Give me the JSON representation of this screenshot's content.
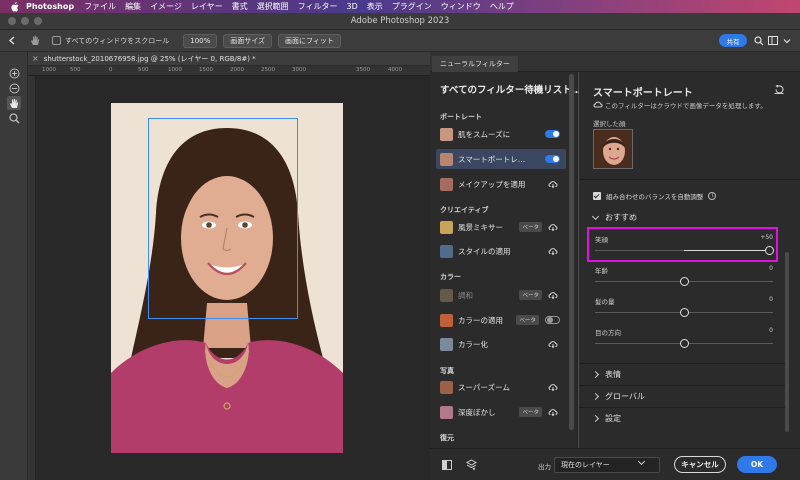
{
  "menubar": {
    "app_name": "Photoshop",
    "items": [
      "ファイル",
      "編集",
      "イメージ",
      "レイヤー",
      "書式",
      "選択範囲",
      "フィルター",
      "3D",
      "表示",
      "プラグイン",
      "ウィンドウ",
      "ヘルプ"
    ]
  },
  "window": {
    "title": "Adobe Photoshop 2023"
  },
  "options_bar": {
    "scroll_all_label": "すべてのウィンドウをスクロール",
    "zoom_button": "100%",
    "fit_screen_button": "画面サイズ",
    "fill_screen_button": "画面にフィット",
    "share_button": "共有"
  },
  "document": {
    "tab_title": "shutterstock_2010676958.jpg @ 25% (レイヤー 0, RGB/8#) *",
    "ruler_ticks": [
      "1000",
      "500",
      "0",
      "500",
      "1000",
      "1500",
      "2000",
      "2500",
      "3000",
      "3500",
      "4000"
    ]
  },
  "neural_filters": {
    "tab_label": "ニューラルフィルター",
    "list_header": "すべてのフィルター待機リスト…",
    "sections": {
      "portrait": "ポートレート",
      "creative": "クリエイティブ",
      "color": "カラー",
      "photo": "写真",
      "restore": "復元"
    },
    "filters": {
      "skin_smoothing": "肌をスムーズに",
      "smart_portrait": "スマートポートレ…",
      "makeup_transfer": "メイクアップを適用",
      "landscape_mixer": "風景ミキサー",
      "style_transfer": "スタイルの適用",
      "harmonization": "調和",
      "color_transfer": "カラーの適用",
      "colorize": "カラー化",
      "super_zoom": "スーパーズーム",
      "depth_blur": "深度ぼかし"
    },
    "beta_label": "ベータ"
  },
  "settings": {
    "title": "スマートポートレート",
    "cloud_note": "このフィルターはクラウドで画像データを処理します。",
    "selected_face_label": "選択した顔",
    "auto_balance_label": "組み合わせのバランスを自動調整",
    "auto_balance_checked": true,
    "recommended_label": "おすすめ",
    "sliders": [
      {
        "name": "笑顔",
        "value": "+50",
        "fraction": 1.0
      },
      {
        "name": "年齢",
        "value": "0",
        "fraction": 0.5
      },
      {
        "name": "髪の量",
        "value": "0",
        "fraction": 0.5
      },
      {
        "name": "目の方向",
        "value": "0",
        "fraction": 0.5
      }
    ],
    "collapsed_sections": [
      "表情",
      "グローバル",
      "設定"
    ]
  },
  "bottom_bar": {
    "output_label": "出力",
    "output_value": "現在のレイヤー",
    "cancel_button": "キャンセル",
    "ok_button": "OK"
  },
  "colors": {
    "accent": "#2f79e8",
    "highlight": "#e010e0",
    "face_box": "#3f8ef0"
  }
}
